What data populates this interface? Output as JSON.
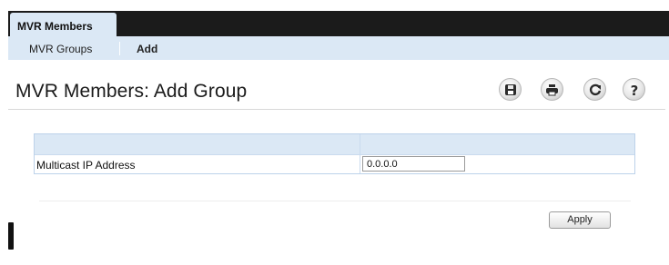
{
  "tabs": {
    "active_label": "MVR Members"
  },
  "subnav": {
    "items": [
      "MVR Groups",
      "Add"
    ]
  },
  "page": {
    "title": "MVR Members: Add Group"
  },
  "toolbar": {
    "icons": [
      "save-icon",
      "print-icon",
      "refresh-icon",
      "help-icon"
    ]
  },
  "form": {
    "field_label": "Multicast IP Address",
    "field_value": "0.0.0.0"
  },
  "actions": {
    "apply_label": "Apply"
  }
}
